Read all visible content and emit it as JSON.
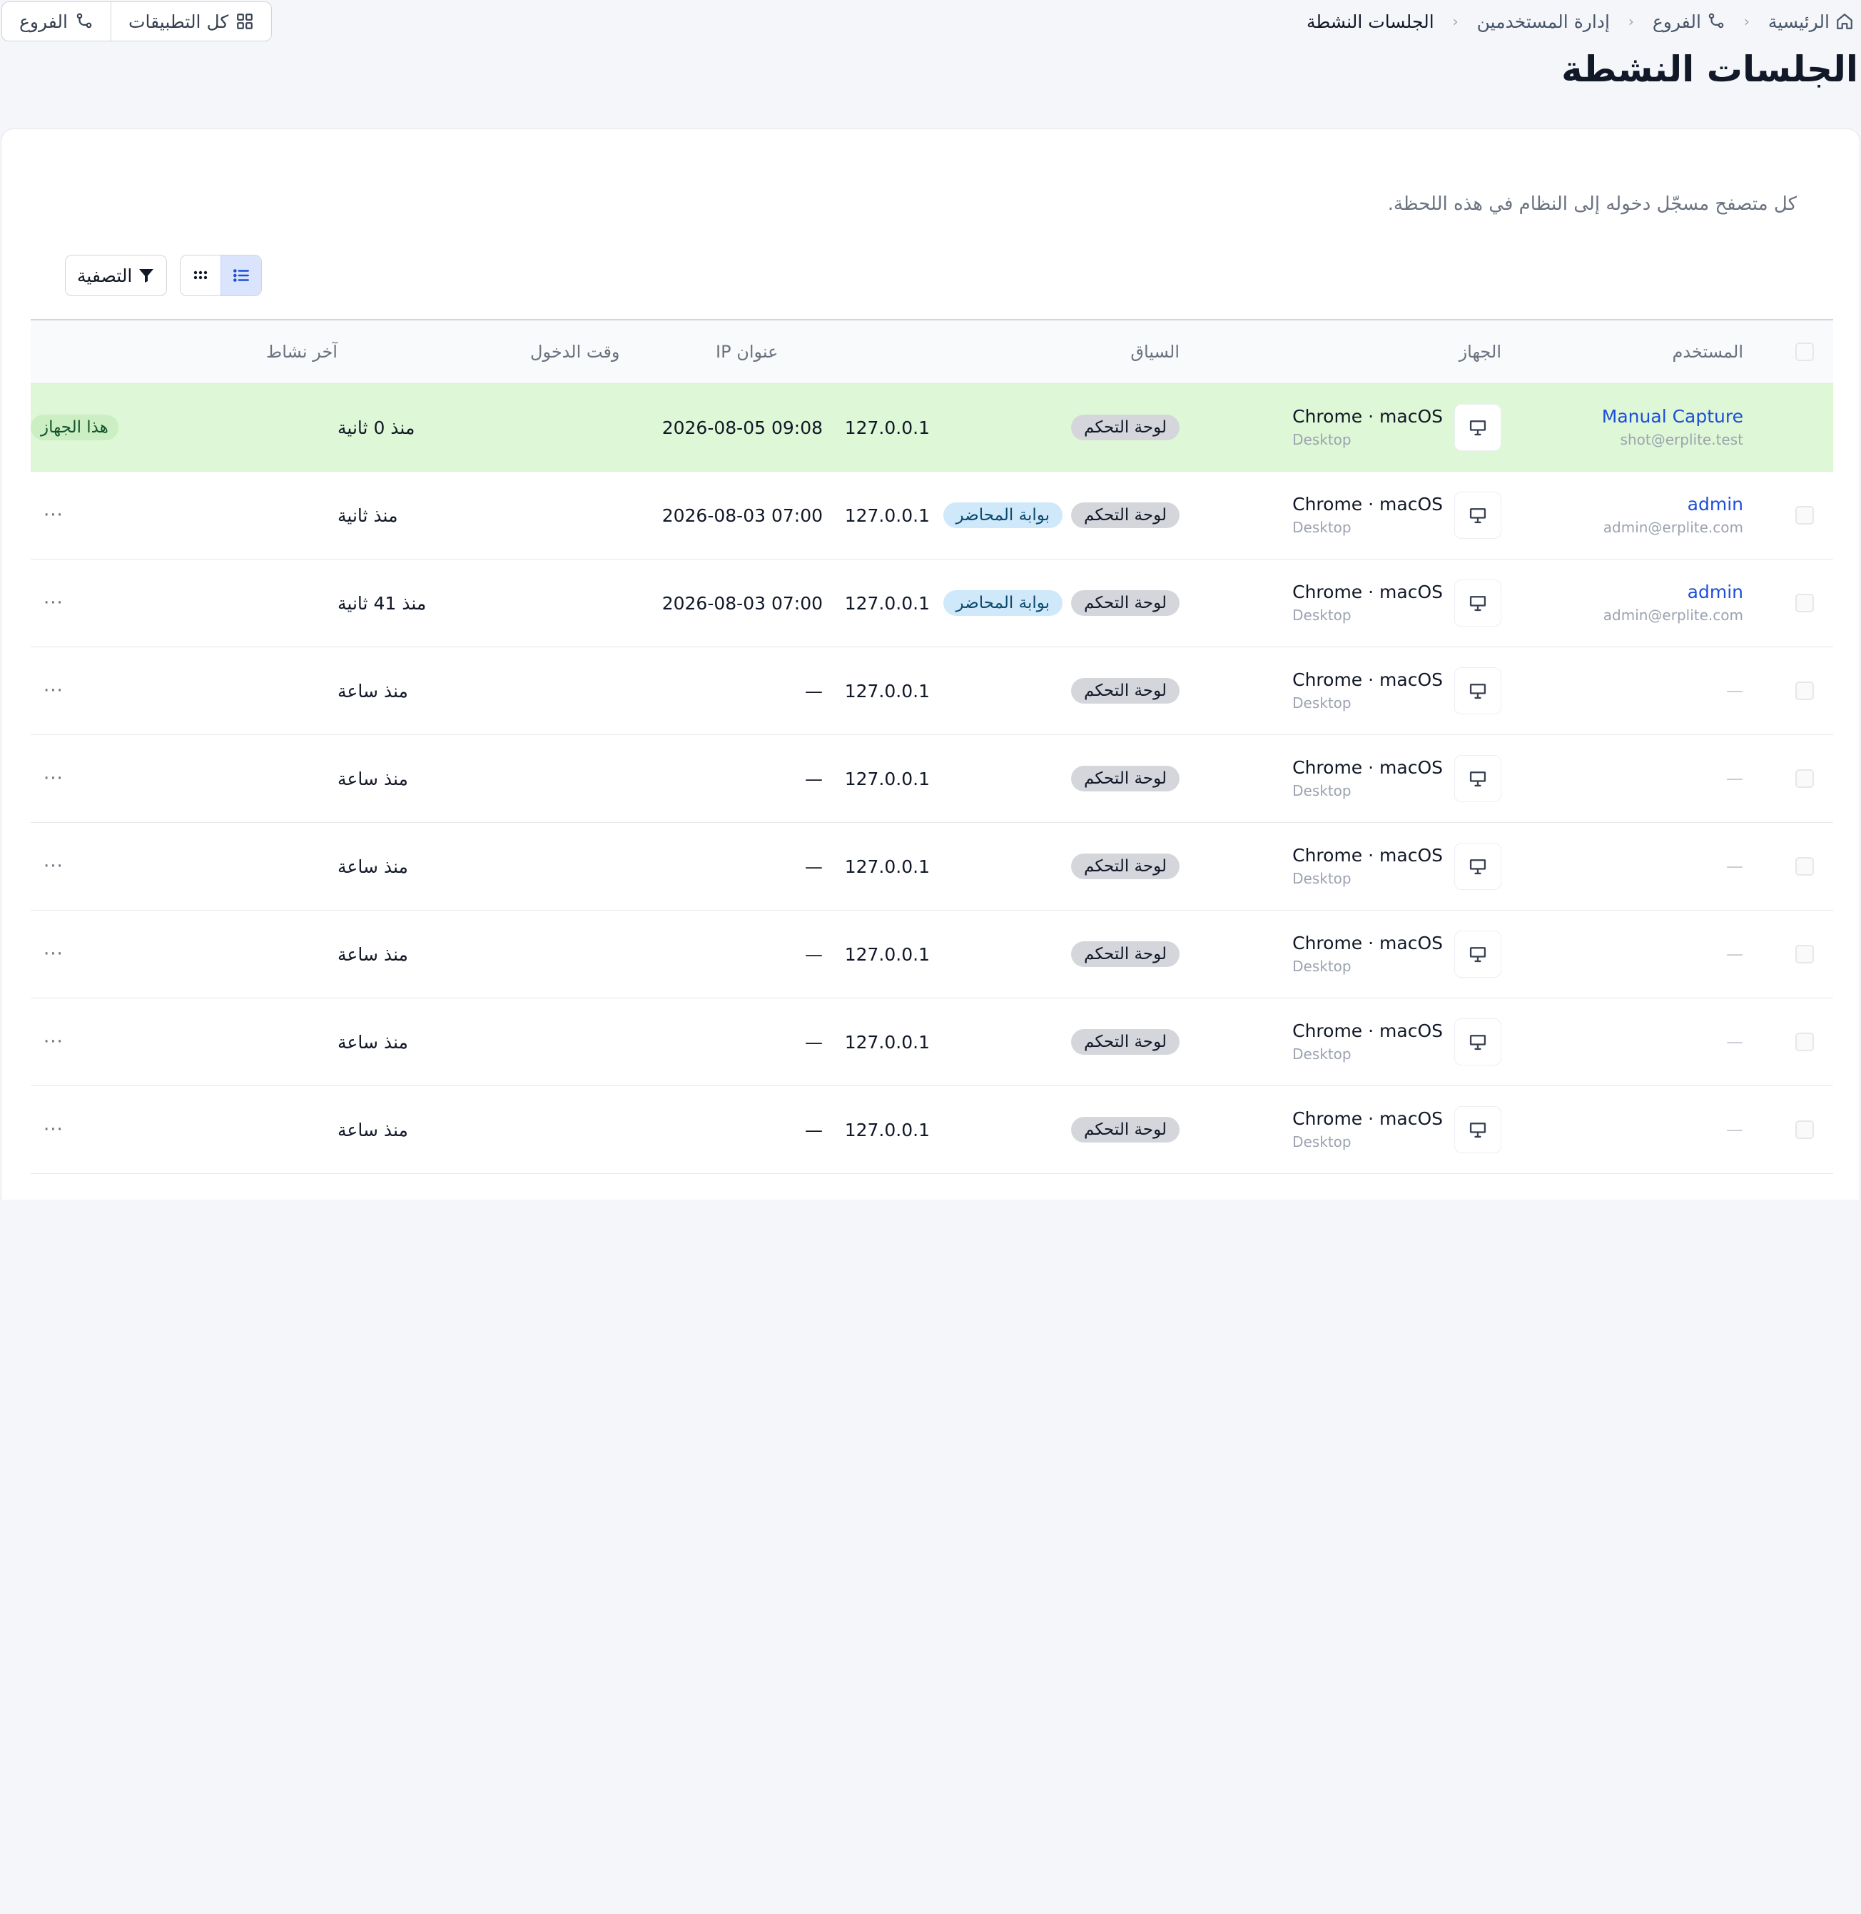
{
  "breadcrumb": {
    "home": "الرئيسية",
    "branches": "الفروع",
    "user_management": "إدارة المستخدمين",
    "current": "الجلسات النشطة"
  },
  "top_actions": {
    "all_apps": "كل التطبيقات",
    "branches": "الفروع"
  },
  "page": {
    "title": "الجلسات النشطة",
    "description": "كل متصفح مسجّل دخوله إلى النظام في هذه اللحظة."
  },
  "toolbar": {
    "filter_label": "التصفية",
    "active_view": "list"
  },
  "table": {
    "headers": {
      "user": "المستخدم",
      "device": "الجهاز",
      "context": "السياق",
      "ip": "عنوان IP",
      "login_time": "وقت الدخول",
      "last_activity": "آخر نشاط"
    },
    "current_device_badge": "هذا الجهاز",
    "rows": [
      {
        "user_name": "Manual Capture",
        "user_email": "shot@erplite.test",
        "device": "Chrome · macOS",
        "device_type": "Desktop",
        "contexts": [
          "لوحة التحكم"
        ],
        "ip": "127.0.0.1",
        "login_time": "2026-08-05 09:08",
        "last_activity": "منذ 0 ثانية",
        "current": true
      },
      {
        "user_name": "admin",
        "user_email": "admin@erplite.com",
        "device": "Chrome · macOS",
        "device_type": "Desktop",
        "contexts": [
          "لوحة التحكم",
          "بوابة المحاضر"
        ],
        "ip": "127.0.0.1",
        "login_time": "2026-08-03 07:00",
        "last_activity": "منذ ثانية",
        "current": false
      },
      {
        "user_name": "admin",
        "user_email": "admin@erplite.com",
        "device": "Chrome · macOS",
        "device_type": "Desktop",
        "contexts": [
          "لوحة التحكم",
          "بوابة المحاضر"
        ],
        "ip": "127.0.0.1",
        "login_time": "2026-08-03 07:00",
        "last_activity": "منذ 41 ثانية",
        "current": false
      },
      {
        "user_name": "—",
        "user_email": "",
        "device": "Chrome · macOS",
        "device_type": "Desktop",
        "contexts": [
          "لوحة التحكم"
        ],
        "ip": "127.0.0.1",
        "login_time": "—",
        "last_activity": "منذ ساعة",
        "current": false
      },
      {
        "user_name": "—",
        "user_email": "",
        "device": "Chrome · macOS",
        "device_type": "Desktop",
        "contexts": [
          "لوحة التحكم"
        ],
        "ip": "127.0.0.1",
        "login_time": "—",
        "last_activity": "منذ ساعة",
        "current": false
      },
      {
        "user_name": "—",
        "user_email": "",
        "device": "Chrome · macOS",
        "device_type": "Desktop",
        "contexts": [
          "لوحة التحكم"
        ],
        "ip": "127.0.0.1",
        "login_time": "—",
        "last_activity": "منذ ساعة",
        "current": false
      },
      {
        "user_name": "—",
        "user_email": "",
        "device": "Chrome · macOS",
        "device_type": "Desktop",
        "contexts": [
          "لوحة التحكم"
        ],
        "ip": "127.0.0.1",
        "login_time": "—",
        "last_activity": "منذ ساعة",
        "current": false
      },
      {
        "user_name": "—",
        "user_email": "",
        "device": "Chrome · macOS",
        "device_type": "Desktop",
        "contexts": [
          "لوحة التحكم"
        ],
        "ip": "127.0.0.1",
        "login_time": "—",
        "last_activity": "منذ ساعة",
        "current": false
      },
      {
        "user_name": "—",
        "user_email": "",
        "device": "Chrome · macOS",
        "device_type": "Desktop",
        "contexts": [
          "لوحة التحكم"
        ],
        "ip": "127.0.0.1",
        "login_time": "—",
        "last_activity": "منذ ساعة",
        "current": false
      }
    ],
    "more_menu_label": "···"
  },
  "colors": {
    "accent": "#1d4ed8",
    "current_row_bg": "#def7d6",
    "page_bg": "#f5f6fa"
  },
  "icons": {
    "home": "home-icon",
    "branches": "branch-icon",
    "all_apps": "grid-icon",
    "filter": "filter-icon",
    "list_view": "list-icon",
    "grid_view": "dots-grid-icon",
    "device": "monitor-icon"
  }
}
